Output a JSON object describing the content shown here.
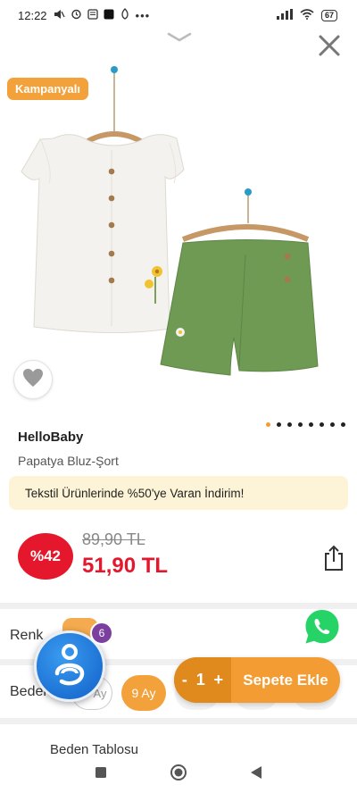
{
  "status_bar": {
    "time": "12:22",
    "battery": "67"
  },
  "badge": {
    "label": "Kampanyalı"
  },
  "product": {
    "brand": "HelloBaby",
    "name": "Papatya Bluz-Şort"
  },
  "promo": {
    "text": "Tekstil Ürünlerinde %50'ye Varan İndirim!"
  },
  "price": {
    "discount": "%42",
    "old": "89,90 TL",
    "new": "51,90 TL"
  },
  "gallery": {
    "image_count": 8,
    "active_index": 0
  },
  "rows": {
    "color_label": "Renk",
    "size_label": "Beden",
    "table_label": "Beden Tablosu"
  },
  "sizes": {
    "selected": "9 Ay",
    "partial": "Ay"
  },
  "cart": {
    "minus": "-",
    "quantity": "1",
    "plus": "+",
    "add_label": "Sepete Ekle"
  },
  "floating": {
    "notification_count": "6"
  },
  "colors": {
    "accent_orange": "#f39c33",
    "price_red": "#e5172c",
    "promo_bg": "#fdf3d6",
    "whatsapp_green": "#25d366"
  },
  "icons": [
    "chevron-down-icon",
    "close-icon",
    "heart-icon",
    "share-icon",
    "whatsapp-icon",
    "stop-icon",
    "home-icon",
    "back-icon"
  ]
}
